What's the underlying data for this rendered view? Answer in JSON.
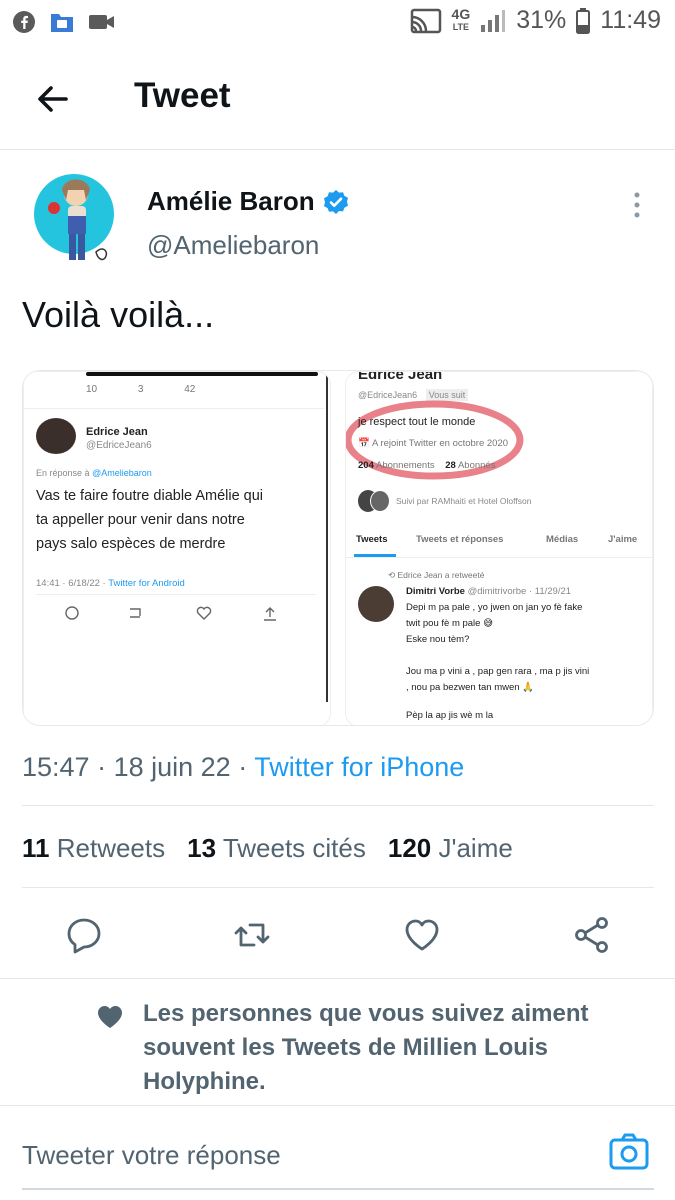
{
  "status_bar": {
    "network": "4G",
    "network_sub": "LTE",
    "battery": "31%",
    "time": "11:49"
  },
  "header": {
    "title": "Tweet"
  },
  "tweet": {
    "author_name": "Amélie Baron",
    "author_handle": "@Ameliebaron",
    "text": "Voilà voilà...",
    "time": "15:47",
    "date": "18 juin 22",
    "source": "Twitter for iPhone"
  },
  "media": {
    "left": {
      "counts": [
        "10",
        "3",
        "42"
      ],
      "name": "Edrice Jean",
      "handle": "@EdriceJean6",
      "reply_to_prefix": "En réponse à",
      "reply_to_handle": "@Ameliebaron",
      "lines": [
        "Vas te faire foutre diable Amélie qui",
        "ta appeller pour venir dans notre",
        "pays salo espèces de merdre"
      ],
      "timestamp": "14:41 · 6/18/22 ·",
      "source": "Twitter for Android"
    },
    "right": {
      "name": "Edrice Jean",
      "handle": "@EdriceJean6",
      "follows_badge": "Vous suit",
      "bio": "je respect tout le monde",
      "joined": "A rejoint Twitter en octobre 2020",
      "following_count": "204",
      "following_label": "Abonnements",
      "followers_count": "28",
      "followers_label": "Abonnés",
      "followed_by": "Suivi par RAMhaiti et Hotel Oloffson",
      "tabs": [
        "Tweets",
        "Tweets et réponses",
        "Médias",
        "J'aime"
      ],
      "retweet_note": "Edrice Jean a retweeté",
      "rt_name": "Dimitri Vorbe",
      "rt_handle": "@dimitrivorbe · 11/29/21",
      "rt_lines": [
        "Depi m pa pale , yo jwen on jan yo fè fake",
        "twit pou fè m pale 😅",
        "Eske nou tèm?",
        "",
        "Jou ma p vini a , pap gen rara , ma p jis vini",
        ", nou pa bezwen tan mwen 🙏",
        "",
        "Pèp la ap jis wè m la"
      ]
    }
  },
  "stats": {
    "retweets_count": "11",
    "retweets_label": "Retweets",
    "quotes_count": "13",
    "quotes_label": "Tweets cités",
    "likes_count": "120",
    "likes_label": "J'aime"
  },
  "social_context": "Les personnes que vous suivez aiment souvent les Tweets de Millien Louis Holyphine.",
  "reply": {
    "placeholder": "Tweeter votre réponse"
  },
  "colors": {
    "accent": "#1d9bf0",
    "text": "#0f1419",
    "secondary": "#536471"
  }
}
